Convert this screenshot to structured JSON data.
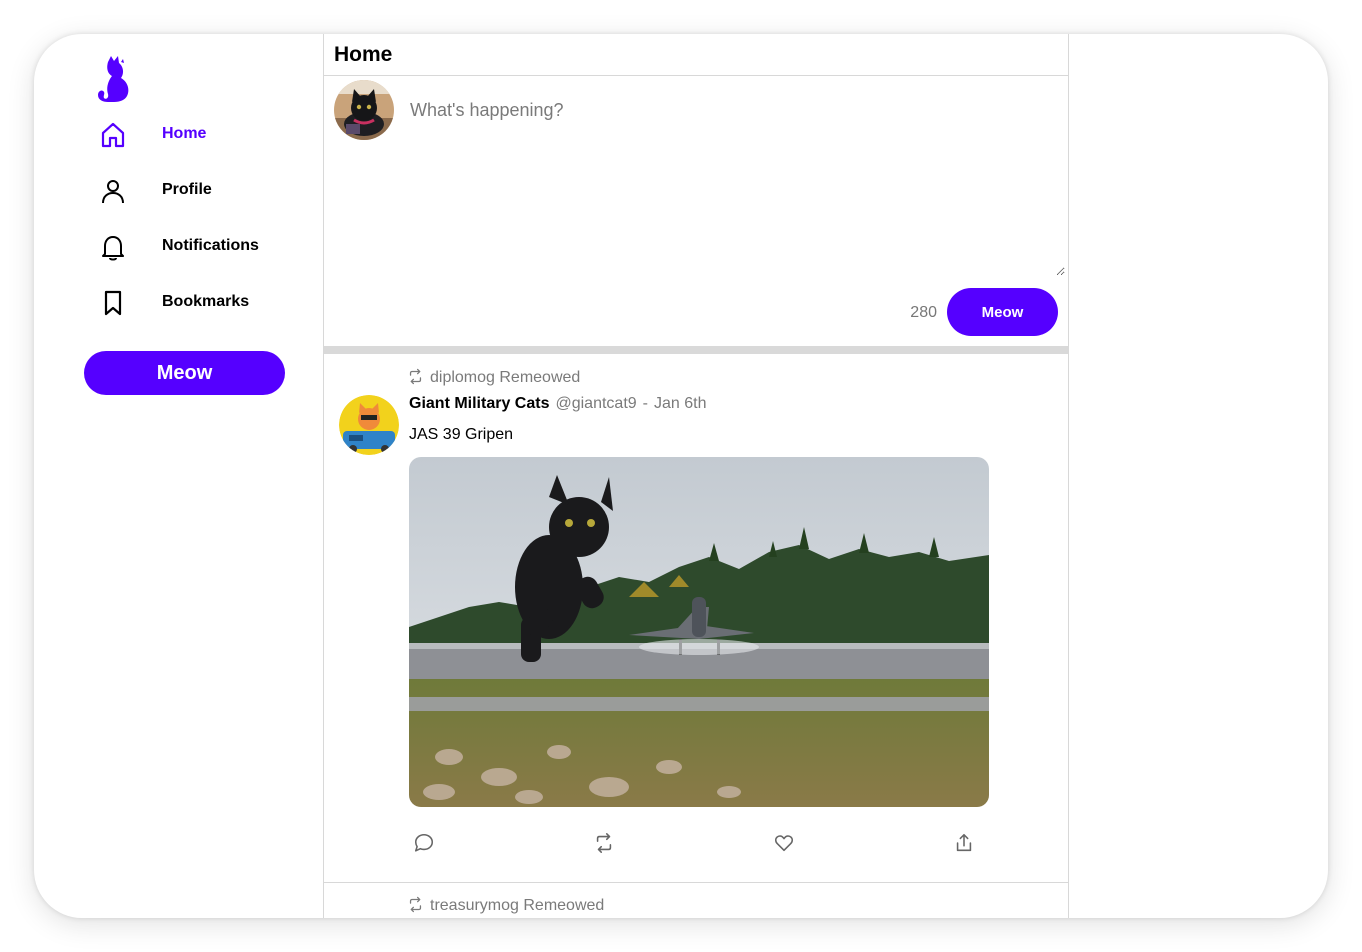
{
  "brand": {
    "accent": "#5500ff",
    "logo_icon": "cat-icon"
  },
  "sidebar": {
    "items": [
      {
        "label": "Home",
        "icon": "home-icon",
        "active": true
      },
      {
        "label": "Profile",
        "icon": "user-icon",
        "active": false
      },
      {
        "label": "Notifications",
        "icon": "bell-icon",
        "active": false
      },
      {
        "label": "Bookmarks",
        "icon": "bookmark-icon",
        "active": false
      }
    ],
    "meow_button": "Meow"
  },
  "header": {
    "title": "Home"
  },
  "composer": {
    "placeholder": "What's happening?",
    "char_remaining": "280",
    "submit_label": "Meow"
  },
  "feed": [
    {
      "remeowed_by": "diplomog Remeowed",
      "author": "Giant Military Cats",
      "handle": "@giantcat9",
      "separator": "-",
      "date": "Jan 6th",
      "text": "JAS 39 Gripen",
      "actions": [
        "reply-icon",
        "remeow-icon",
        "like-icon",
        "share-icon"
      ]
    },
    {
      "remeowed_by": "treasurymog Remeowed"
    }
  ]
}
